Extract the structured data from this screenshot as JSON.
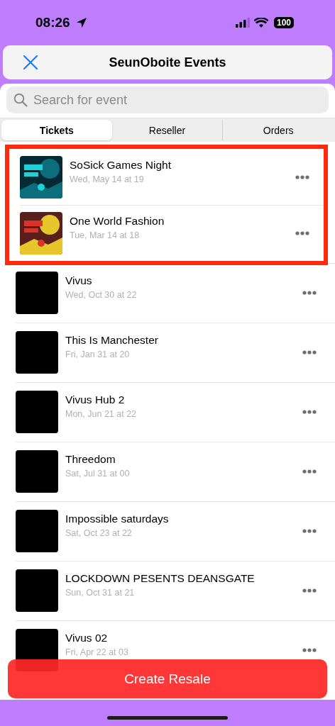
{
  "status_bar": {
    "time": "08:26",
    "battery": "100"
  },
  "header": {
    "title": "SeunOboite Events"
  },
  "search": {
    "placeholder": "Search for event"
  },
  "tabs": [
    {
      "label": "Tickets",
      "selected": true
    },
    {
      "label": "Reseller",
      "selected": false
    },
    {
      "label": "Orders",
      "selected": false
    }
  ],
  "events": [
    {
      "title": "SoSick Games Night",
      "date": "Wed, May 14 at 19",
      "kind": "picture",
      "highlighted": true
    },
    {
      "title": "One World Fashion",
      "date": "Tue, Mar 14 at 18",
      "kind": "picture",
      "highlighted": true
    },
    {
      "title": "Vivus",
      "date": "Wed, Oct 30 at 22",
      "kind": "blank",
      "highlighted": false
    },
    {
      "title": "This Is Manchester",
      "date": "Fri, Jan 31 at 20",
      "kind": "blank",
      "highlighted": false
    },
    {
      "title": "Vivus Hub 2",
      "date": "Mon, Jun 21 at 22",
      "kind": "blank",
      "highlighted": false
    },
    {
      "title": "Threedom",
      "date": "Sat, Jul 31 at 00",
      "kind": "blank",
      "highlighted": false
    },
    {
      "title": "Impossible saturdays",
      "date": "Sat, Oct 23 at 22",
      "kind": "blank",
      "highlighted": false
    },
    {
      "title": "LOCKDOWN PESENTS DEANSGATE",
      "date": "Sun, Oct 31 at 21",
      "kind": "blank",
      "highlighted": false
    },
    {
      "title": "Vivus 02",
      "date": "Fri, Apr 22 at 03",
      "kind": "blank",
      "highlighted": false
    }
  ],
  "action_button": {
    "label": "Create Resale"
  }
}
